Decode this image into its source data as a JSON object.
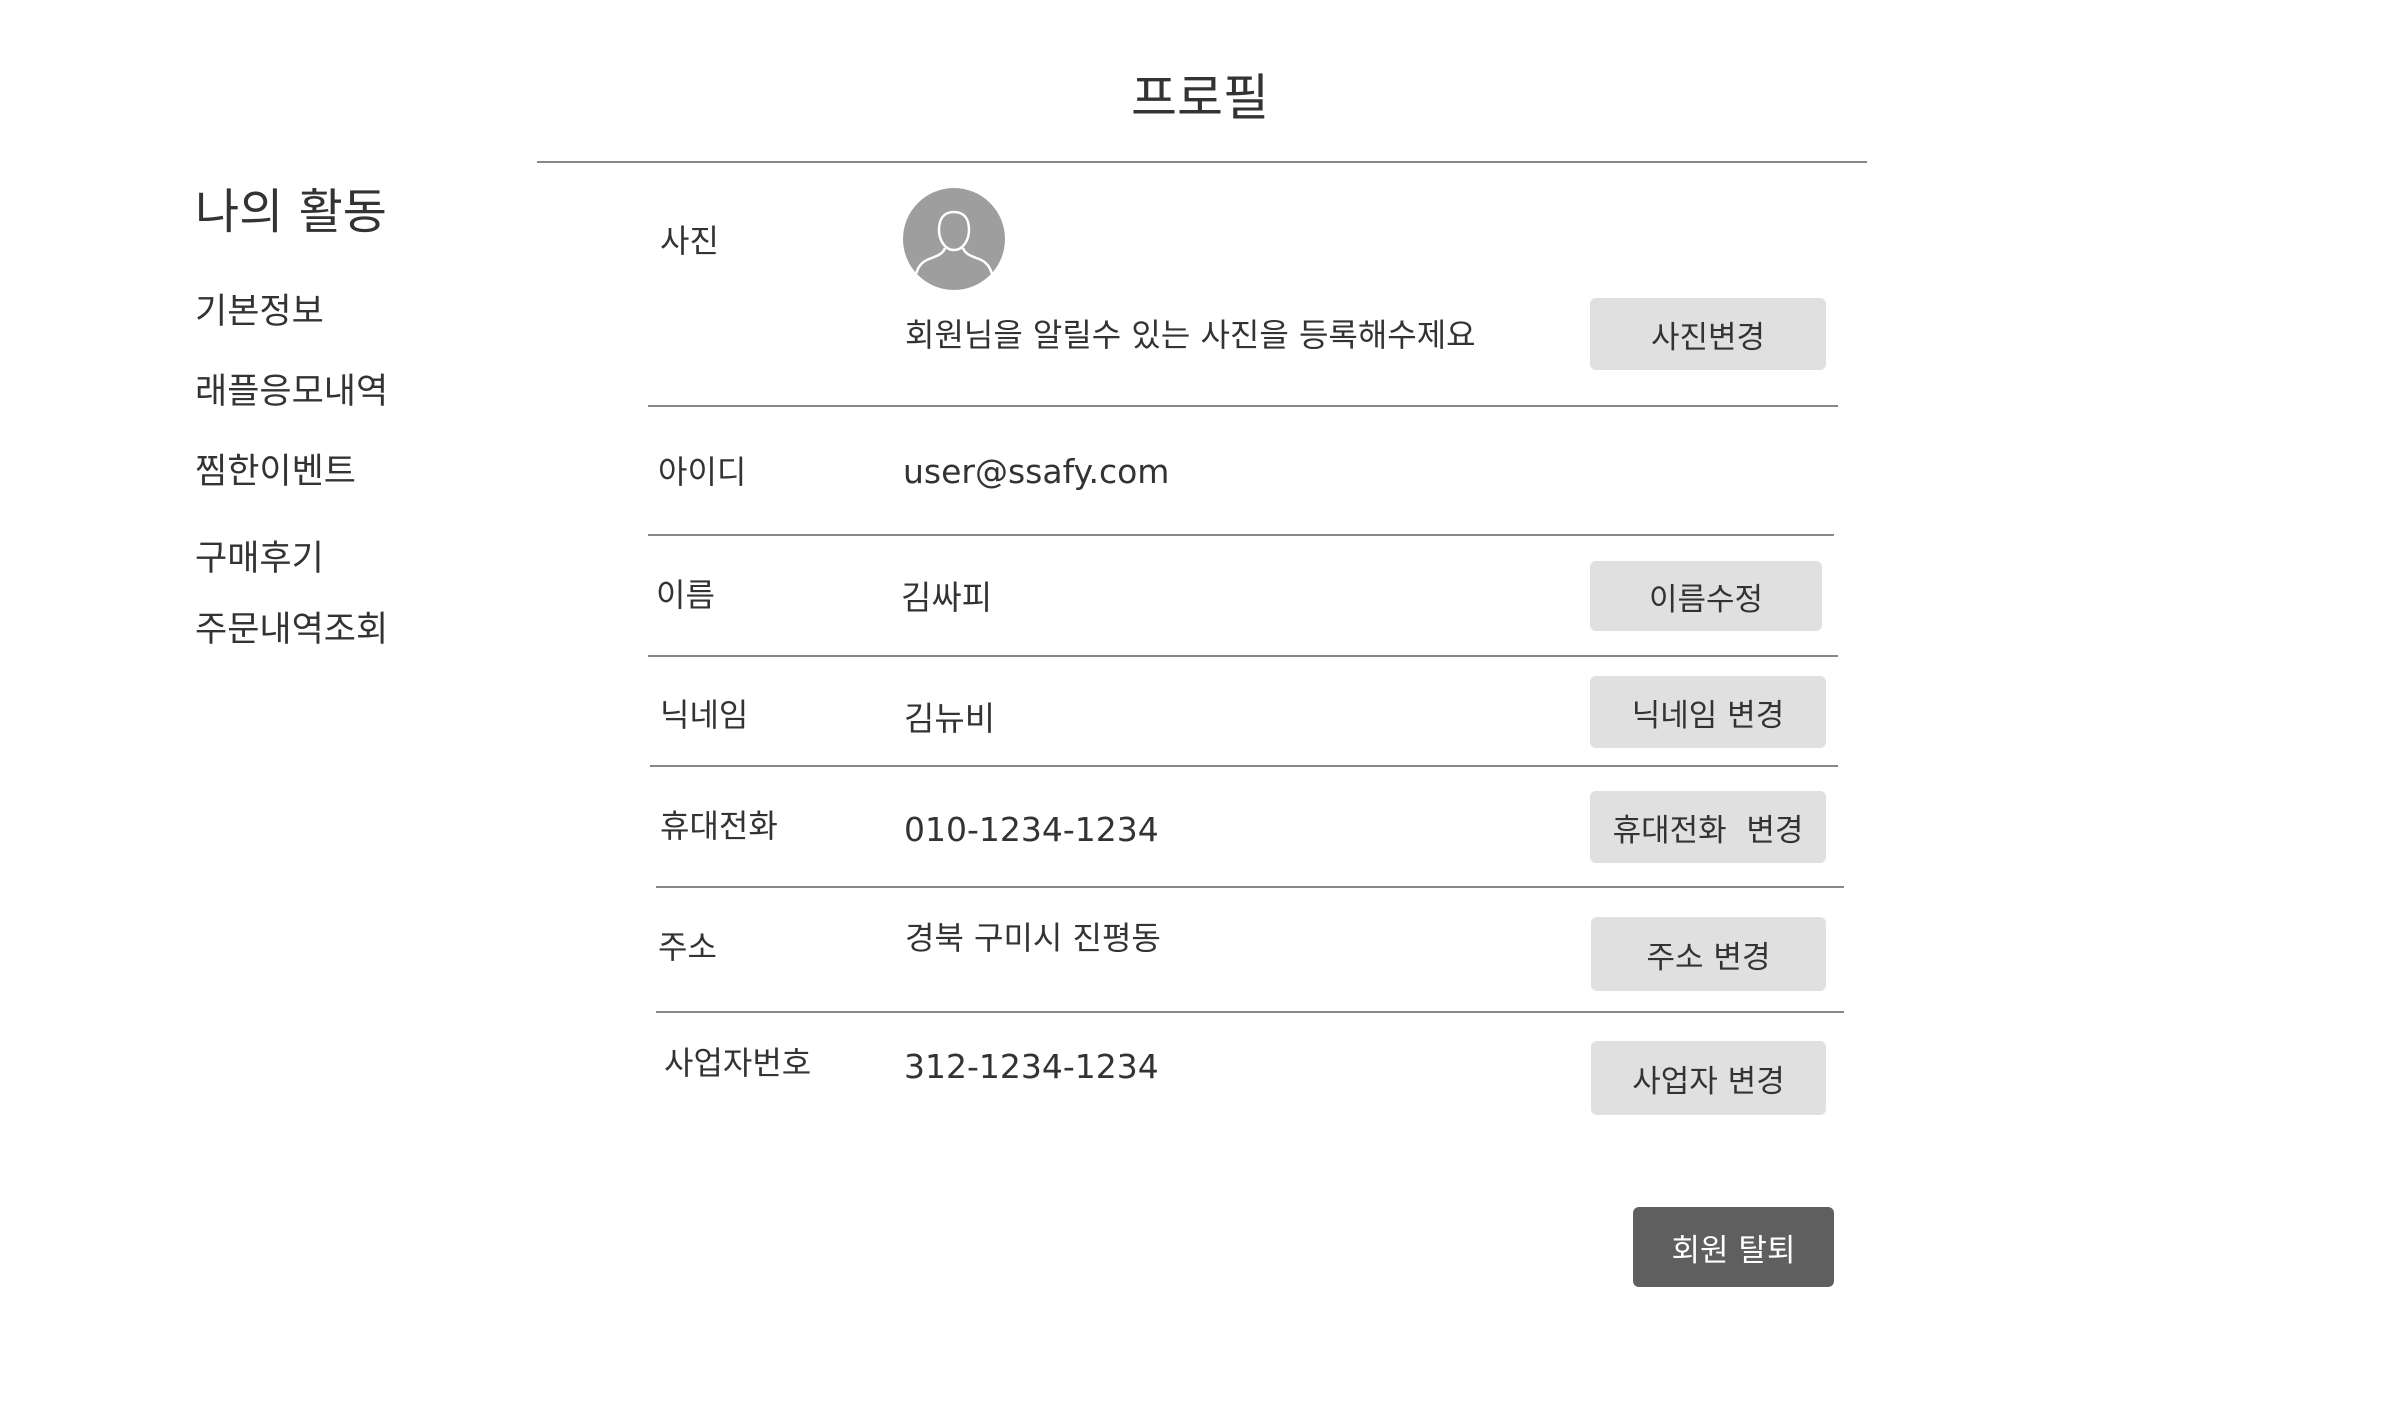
{
  "header": {
    "title": "프로필"
  },
  "sidebar": {
    "title": "나의 활동",
    "items": [
      {
        "label": "기본정보"
      },
      {
        "label": "래플응모내역"
      },
      {
        "label": "찜한이벤트"
      },
      {
        "label": "구매후기"
      },
      {
        "label": "주문내역조회"
      }
    ]
  },
  "profile": {
    "photo": {
      "label": "사진",
      "description": "회원님을 알릴수 있는 사진을 등록해수제요",
      "button": "사진변경",
      "avatar_icon": "user-silhouette"
    },
    "id": {
      "label": "아이디",
      "value": "user@ssafy.com"
    },
    "name": {
      "label": "이름",
      "value": "김싸피",
      "button": "이름수정"
    },
    "nickname": {
      "label": "닉네임",
      "value": "김뉴비",
      "button": "닉네임 변경"
    },
    "phone": {
      "label": "휴대전화",
      "value": "010-1234-1234",
      "button": "휴대전화  변경"
    },
    "address": {
      "label": "주소",
      "value": "경북 구미시 진평동",
      "button": "주소 변경"
    },
    "business": {
      "label": "사업자번호",
      "value": "312-1234-1234",
      "button": "사업자 변경"
    }
  },
  "withdraw": {
    "label": "회원 탈퇴"
  },
  "colors": {
    "button_bg": "#e0e0e0",
    "dark_button_bg": "#5f5f5f",
    "avatar_bg": "#9e9e9e",
    "rule": "#888888",
    "text": "#333333"
  }
}
